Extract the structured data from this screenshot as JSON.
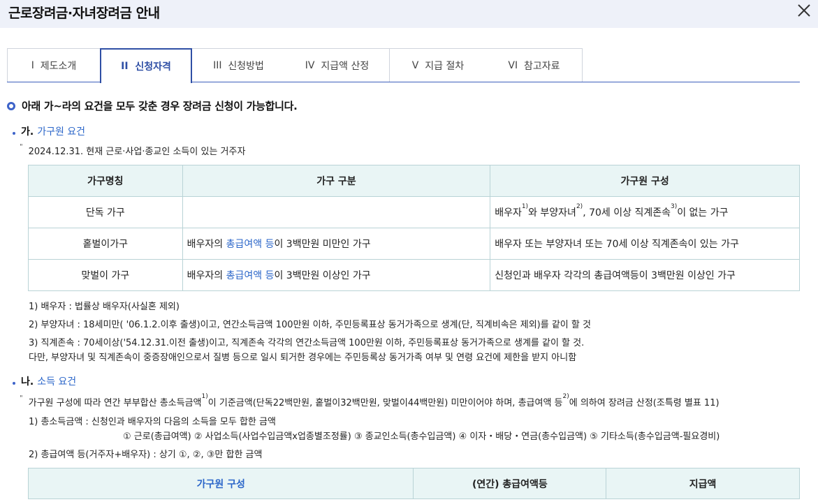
{
  "window": {
    "title": "근로장려금·자녀장려금 안내",
    "close_icon": "close-icon"
  },
  "tabs": [
    {
      "num": "I",
      "label": "제도소개",
      "active": false
    },
    {
      "num": "II",
      "label": "신청자격",
      "active": true
    },
    {
      "num": "III",
      "label": "신청방법",
      "active": false
    },
    {
      "num": "IV",
      "label": "지급액 산정",
      "active": false
    },
    {
      "num": "V",
      "label": "지급 절차",
      "active": false
    },
    {
      "num": "VI",
      "label": "참고자료",
      "active": false
    }
  ],
  "headline": "아래 가~라의 요건을 모두 갖춘 경우 장려금 신청이 가능합니다.",
  "section_a": {
    "key": "가.",
    "title": "가구원 요건",
    "note": "2024.12.31. 현재 근로·사업·종교인 소득이 있는 거주자",
    "table": {
      "headers": [
        "가구명칭",
        "가구 구분",
        "가구원 구성"
      ],
      "rows": [
        {
          "name": "단독 가구",
          "type_pre": "",
          "type_link": "",
          "type_post": "",
          "comp_p1": "배우자",
          "comp_s1": "1)",
          "comp_p2": "와 부양자녀",
          "comp_s2": "2)",
          "comp_p3": ", 70세 이상 직계존속",
          "comp_s3": "3)",
          "comp_p4": "이 없는 가구"
        },
        {
          "name": "홑벌이가구",
          "type_pre": "배우자의 ",
          "type_link": "총급여액 등",
          "type_post": "이 3백만원 미만인 가구",
          "comp_text": "배우자 또는 부양자녀 또는 70세 이상 직계존속이 있는 가구"
        },
        {
          "name": "맞벌이 가구",
          "type_pre": "배우자의 ",
          "type_link": "총급여액 등",
          "type_post": "이 3백만원 이상인 가구",
          "comp_text": "신청인과 배우자 각각의 총급여액등이 3백만원 이상인 가구"
        }
      ]
    },
    "footnotes": [
      "1) 배우자 : 법률상 배우자(사실혼 제외)",
      "2) 부양자녀 : 18세미만( '06.1.2.이후 출생)이고, 연간소득금액 100만원 이하, 주민등록표상 동거가족으로 생계(단, 직계비속은 제외)를 같이 할 것",
      "3) 직계존속 : 70세이상('54.12.31.이전 출생)이고, 직계존속 각각의 연간소득금액 100만원 이하, 주민등록표상 동거가족으로 생계를 같이 할 것.",
      "다만, 부양자녀 및 직계존속이 중증장애인으로서 질병 등으로 일시 퇴거한 경우에는 주민등록상 동거가족 여부 및 연령 요건에 제한을 받지 아니함"
    ]
  },
  "section_b": {
    "key": "나.",
    "title": "소득 요건",
    "note_p1": "가구원 구성에 따라 연간 부부합산 총소득금액",
    "note_s1": "1)",
    "note_p2": "이 기준금액(단독22백만원, 홑벌이32백만원, 맞벌이44백만원) 미만이어야 하며, 총급여액 등",
    "note_s2": "2)",
    "note_p3": "에 의하여 장려금 산정(조특령 별표 11)",
    "item1": "1) 총소득금액 : 신청인과 배우자의 다음의 소득을 모두 합한 금액",
    "item1_detail": "① 근로(총급여액) ② 사업소득(사업수입금액x업종별조정률) ③ 종교인소득(총수입금액) ④ 이자・배당・연금(총수입금액) ⑤ 기타소득(총수입금액-필요경비)",
    "item2": "2) 총급여액 등(거주자+배우자) : 상기 ①, ②, ③만 합한 금액",
    "table_headers": [
      "가구원 구성",
      "(연간) 총급여액등",
      "지급액"
    ]
  }
}
